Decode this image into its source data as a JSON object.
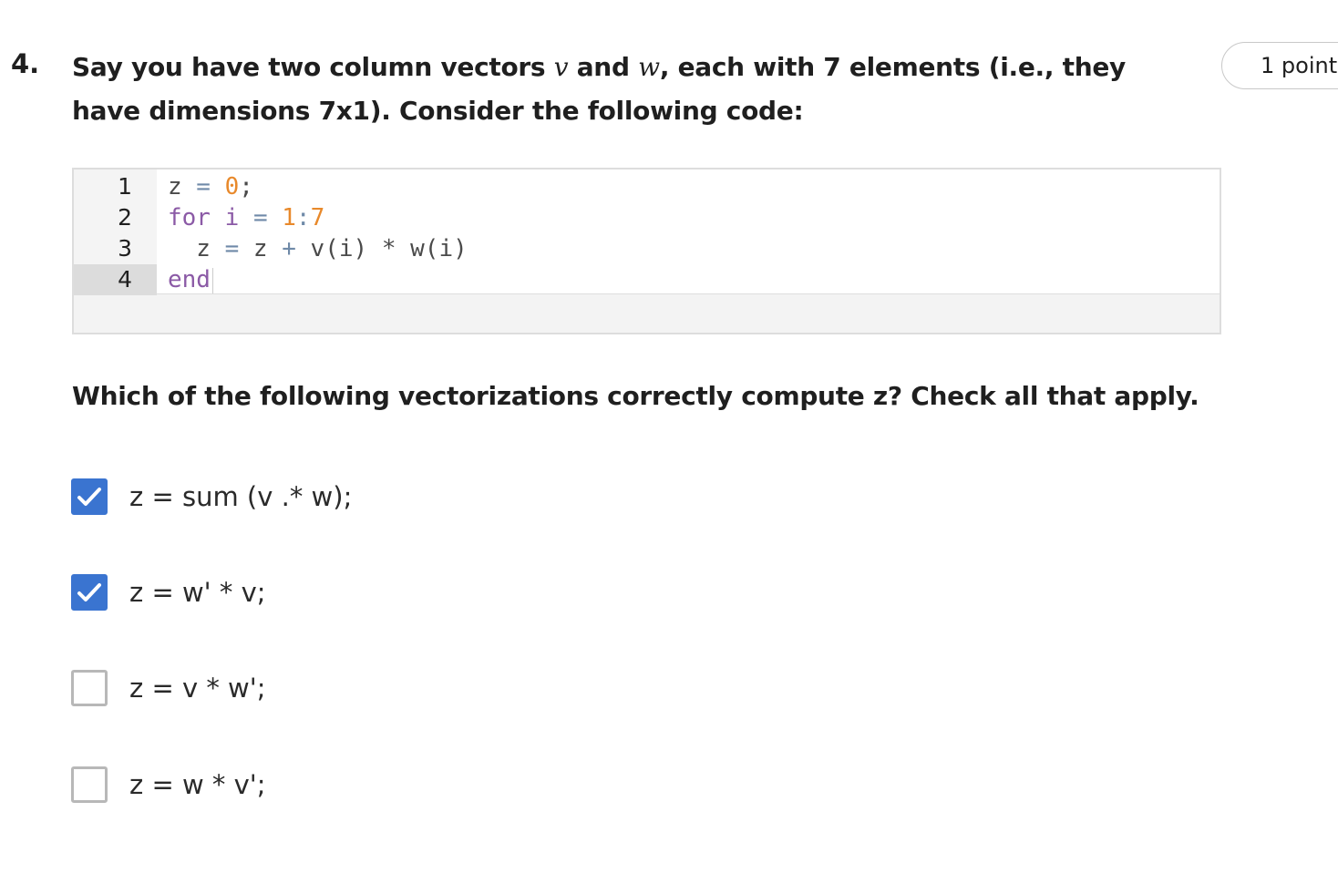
{
  "question": {
    "number": "4.",
    "text_part1": "Say you have two column vectors ",
    "var_v": "v",
    "text_part2": " and ",
    "var_w": "w",
    "text_part3": ", each with 7 elements (i.e., they have dimensions 7x1). Consider the following code:",
    "points": "1 point"
  },
  "code": {
    "lines": [
      {
        "num": "1",
        "tokens": [
          "z",
          " = ",
          "0",
          ";"
        ]
      },
      {
        "num": "2",
        "tokens": [
          "for",
          " i ",
          "=",
          " ",
          "1",
          ":",
          "7"
        ]
      },
      {
        "num": "3",
        "tokens": [
          "  z ",
          "=",
          " z ",
          "+",
          " v(i) * w(i)"
        ]
      },
      {
        "num": "4",
        "tokens": [
          "end"
        ]
      }
    ]
  },
  "instruction": "Which of the following vectorizations correctly compute z? Check all that apply.",
  "options": [
    {
      "label": "z = sum (v .* w);",
      "checked": true
    },
    {
      "label": "z = w' * v;",
      "checked": true
    },
    {
      "label": "z = v * w';",
      "checked": false
    },
    {
      "label": "z = w * v';",
      "checked": false
    }
  ],
  "colors": {
    "checkbox_checked": "#3a74d0",
    "checkbox_border": "#b8b8b8",
    "keyword": "#8b5aa6",
    "number": "#e8892b",
    "operator": "#6f8aa8"
  },
  "icons": {
    "checkmark": "checkmark-icon"
  }
}
